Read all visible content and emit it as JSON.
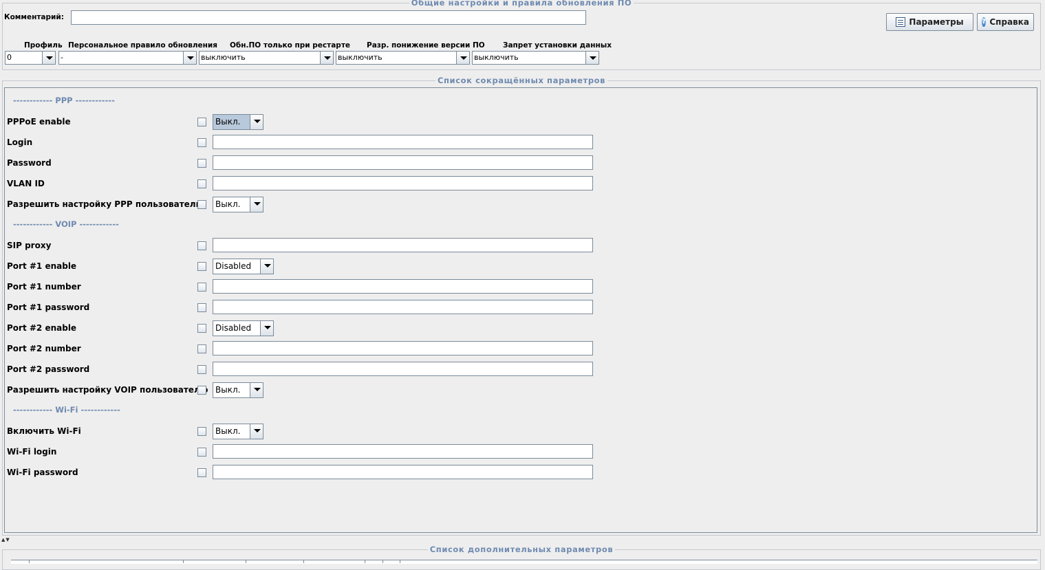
{
  "top_panel": {
    "title": "Общие настройки и правила обновления ПО",
    "comment_label": "Комментарий:",
    "comment_value": "",
    "params_button": "Параметры",
    "help_button": "Справка",
    "columns": [
      {
        "label": "Профиль",
        "value": "0"
      },
      {
        "label": "Персональное правило обновления",
        "value": "-"
      },
      {
        "label": "Обн.ПО только при рестарте",
        "value": "выключить"
      },
      {
        "label": "Разр. понижение версии ПО",
        "value": "выключить"
      },
      {
        "label": "Запрет установки данных",
        "value": "выключить"
      }
    ]
  },
  "short_params": {
    "title": "Список  сокращённых  параметров",
    "sections": {
      "ppp": "------------ PPP ------------",
      "voip": "------------ VOIP ------------",
      "wifi": "------------ Wi-Fi ------------"
    },
    "rows": {
      "pppoe_enable": {
        "label": "PPPoE enable",
        "value": "Выкл."
      },
      "login": {
        "label": "Login",
        "value": ""
      },
      "password": {
        "label": "Password",
        "value": ""
      },
      "vlan_id": {
        "label": "VLAN ID",
        "value": ""
      },
      "allow_ppp_user": {
        "label": "Разрешить настройку PPP пользователю",
        "value": "Выкл."
      },
      "sip_proxy": {
        "label": "SIP proxy",
        "value": ""
      },
      "port1_enable": {
        "label": "Port #1 enable",
        "value": "Disabled"
      },
      "port1_number": {
        "label": "Port #1 number",
        "value": ""
      },
      "port1_password": {
        "label": "Port #1 password",
        "value": ""
      },
      "port2_enable": {
        "label": "Port #2 enable",
        "value": "Disabled"
      },
      "port2_number": {
        "label": "Port #2 number",
        "value": ""
      },
      "port2_password": {
        "label": "Port #2 password",
        "value": ""
      },
      "allow_voip_user": {
        "label": "Разрешить настройку VOIP пользователю",
        "value": "Выкл."
      },
      "wifi_enable": {
        "label": "Включить Wi-Fi",
        "value": "Выкл."
      },
      "wifi_login": {
        "label": "Wi-Fi login",
        "value": ""
      },
      "wifi_password": {
        "label": "Wi-Fi password",
        "value": ""
      }
    }
  },
  "extra_params": {
    "title": "Список  дополнительных  параметров"
  }
}
